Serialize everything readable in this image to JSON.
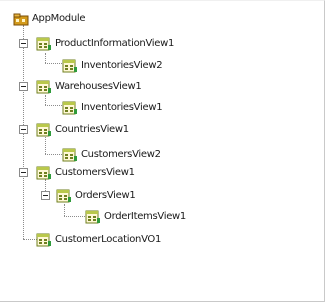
{
  "tree": {
    "root": {
      "label": "AppModule",
      "icon": "application-module-icon",
      "expanded": true
    },
    "nodes": [
      {
        "label": "ProductInformationView1",
        "icon": "view-object-icon",
        "expanded": true,
        "children": [
          {
            "label": "InventoriesView2",
            "icon": "view-object-icon"
          }
        ]
      },
      {
        "label": "WarehousesView1",
        "icon": "view-object-icon",
        "expanded": true,
        "children": [
          {
            "label": "InventoriesView1",
            "icon": "view-object-icon"
          }
        ]
      },
      {
        "label": "CountriesView1",
        "icon": "view-object-icon",
        "expanded": true,
        "children": [
          {
            "label": "CustomersView2",
            "icon": "view-object-icon"
          }
        ]
      },
      {
        "label": "CustomersView1",
        "icon": "view-object-icon",
        "expanded": true,
        "children": [
          {
            "label": "OrdersView1",
            "icon": "view-object-icon",
            "expanded": true,
            "children": [
              {
                "label": "OrderItemsView1",
                "icon": "view-object-icon"
              }
            ]
          }
        ]
      },
      {
        "label": "CustomerLocationVO1",
        "icon": "view-object-icon"
      }
    ]
  }
}
